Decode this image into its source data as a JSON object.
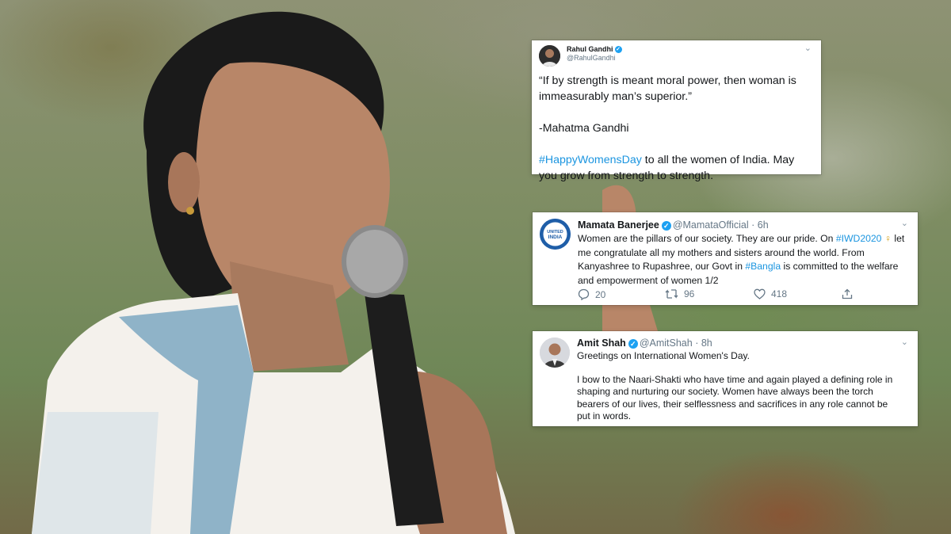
{
  "tweets": [
    {
      "name": "Rahul Gandhi",
      "handle": "@RahulGandhi",
      "line1": "“If by strength is meant moral power, then woman is immeasurably man’s superior.”",
      "line2": "-Mahatma Gandhi",
      "hashtag": "#HappyWomensDay",
      "line3": " to all the women of India. May you grow from strength to strength."
    },
    {
      "name": "Mamata Banerjee",
      "handle": "@MamataOfficial",
      "time": "· 6h",
      "text_a": "Women are the pillars of our society. They are our pride. On ",
      "hashtag_a": "#IWD2020",
      "emoji": "♀",
      "text_b": " let me congratulate all my mothers and sisters around the world. From Kanyashree to Rupashree, our Govt in ",
      "hashtag_b": "#Bangla",
      "text_c": " is committed to the welfare and empowerment of women 1/2",
      "avatar_text": "UNITED INDIA",
      "replies": "20",
      "retweets": "96",
      "likes": "418"
    },
    {
      "name": "Amit Shah",
      "handle": "@AmitShah",
      "time": "· 8h",
      "para1": "Greetings on International Women's Day.",
      "para2": "I bow to the Naari-Shakti who have time and again played a defining role in shaping and nurturing our society. Women have always been the torch bearers of our lives, their selflessness and sacrifices in any role cannot be put in words."
    }
  ],
  "icons": {
    "verified": "check-badge",
    "chevron": "chevron-down",
    "reply": "speech-bubble",
    "retweet": "retweet-arrows",
    "like": "heart",
    "share": "upload-arrow"
  },
  "colors": {
    "hashtag": "#1b95e0",
    "verified": "#1da1f2",
    "meta": "#657786"
  }
}
